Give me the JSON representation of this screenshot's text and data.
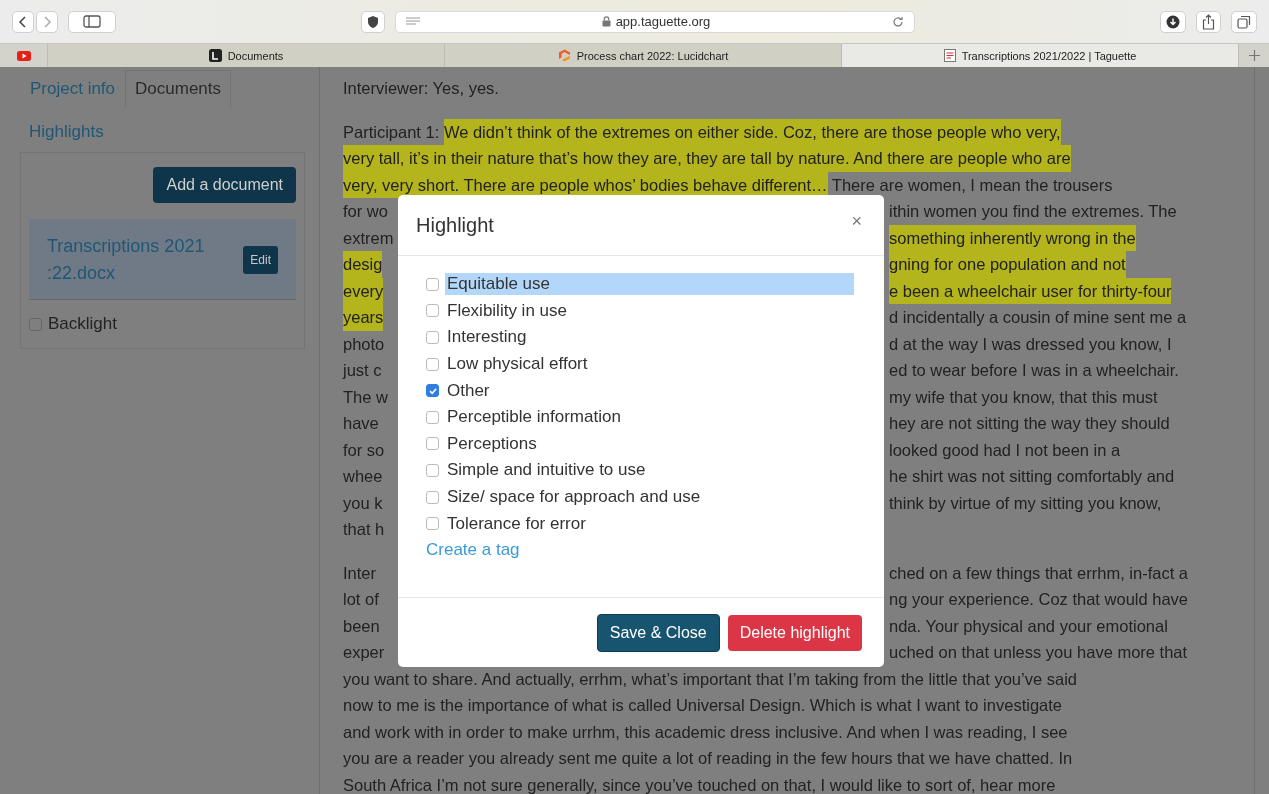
{
  "browser": {
    "address": "app.taguette.org",
    "tabs": [
      {
        "title": "Documents",
        "selected": false
      },
      {
        "title": "Process chart 2022: Lucidchart",
        "selected": false
      },
      {
        "title": "Transcriptions 2021/2022 | Taguette",
        "selected": true
      }
    ]
  },
  "sidebar": {
    "tabs": [
      {
        "label": "Project info",
        "selected": false
      },
      {
        "label": "Documents",
        "selected": true
      }
    ],
    "highlights_link": "Highlights",
    "add_button": "Add a document",
    "document": {
      "name_lines": [
        "Transcriptions 2021",
        ":22.docx"
      ],
      "edit": "Edit"
    },
    "filters": [
      {
        "label": "Backlight",
        "checked": false
      }
    ]
  },
  "document": {
    "paragraphs": [
      {
        "lines": [
          {
            "kind": "full",
            "segments": [
              {
                "text": "Interviewer: Yes, yes.",
                "highlighted": false
              }
            ]
          }
        ]
      },
      {
        "lines": [
          {
            "kind": "full",
            "segments": [
              {
                "text": "Participant 1: ",
                "highlighted": false
              },
              {
                "text": "We didn’t think of the extremes on either side. Coz, there are those people who very,",
                "highlighted": true
              }
            ]
          },
          {
            "kind": "full",
            "segments": [
              {
                "text": "very tall, it’s in their nature that’s how they are, they are tall by nature. And there are people who are",
                "highlighted": true
              }
            ]
          },
          {
            "kind": "full",
            "segments": [
              {
                "text": "very, very short. There are people whos’ bodies behave different…",
                "highlighted": true
              },
              {
                "text": " There are women, I mean the trousers",
                "highlighted": false
              }
            ]
          },
          {
            "kind": "split",
            "left": [
              {
                "text": "for wo",
                "highlighted": false
              }
            ],
            "right": [
              {
                "text": "ithin women you find the extremes. The",
                "highlighted": false
              }
            ]
          },
          {
            "kind": "split",
            "left": [
              {
                "text": "extrem",
                "highlighted": false
              }
            ],
            "right": [
              {
                "text": "something inherently wrong in the",
                "highlighted": true
              }
            ]
          },
          {
            "kind": "split",
            "left": [
              {
                "text": "desig",
                "highlighted": true
              }
            ],
            "right": [
              {
                "text": "gning for one population and not",
                "highlighted": true
              }
            ]
          },
          {
            "kind": "split",
            "left": [
              {
                "text": "every",
                "highlighted": true
              }
            ],
            "right": [
              {
                "text": "e been a wheelchair user for thirty-four",
                "highlighted": true
              }
            ]
          },
          {
            "kind": "split",
            "left": [
              {
                "text": "years",
                "highlighted": true
              }
            ],
            "right": [
              {
                "text": "d incidentally a cousin of mine sent me a",
                "highlighted": false
              }
            ]
          },
          {
            "kind": "split",
            "left": [
              {
                "text": "photo",
                "highlighted": false
              }
            ],
            "right": [
              {
                "text": "d at the way I was dressed you know, I",
                "highlighted": false
              }
            ]
          },
          {
            "kind": "split",
            "left": [
              {
                "text": "just c",
                "highlighted": false
              }
            ],
            "right": [
              {
                "text": "ed to wear before I was in a wheelchair.",
                "highlighted": false
              }
            ]
          },
          {
            "kind": "split",
            "left": [
              {
                "text": "The w",
                "highlighted": false
              }
            ],
            "right": [
              {
                "text": "my wife that you know, that this must",
                "highlighted": false
              }
            ]
          },
          {
            "kind": "split",
            "left": [
              {
                "text": "have",
                "highlighted": false
              }
            ],
            "right": [
              {
                "text": "hey are not sitting the way they should",
                "highlighted": false
              }
            ]
          },
          {
            "kind": "split",
            "left": [
              {
                "text": "for so",
                "highlighted": false
              }
            ],
            "right": [
              {
                "text": "looked good had I not been in a",
                "highlighted": false
              }
            ]
          },
          {
            "kind": "split",
            "left": [
              {
                "text": "whee",
                "highlighted": false
              }
            ],
            "right": [
              {
                "text": "he shirt was not sitting comfortably and",
                "highlighted": false
              }
            ]
          },
          {
            "kind": "split",
            "left": [
              {
                "text": "you k",
                "highlighted": false
              }
            ],
            "right": [
              {
                "text": "think by virtue of my sitting you know,",
                "highlighted": false
              }
            ]
          },
          {
            "kind": "split",
            "left": [
              {
                "text": "that h",
                "highlighted": false
              }
            ]
          }
        ]
      },
      {
        "lines": [
          {
            "kind": "split",
            "left": [
              {
                "text": "Inter",
                "highlighted": false
              }
            ],
            "right": [
              {
                "text": "ched on a few things that errhm, in-fact a",
                "highlighted": false
              }
            ]
          },
          {
            "kind": "split",
            "left": [
              {
                "text": "lot of",
                "highlighted": false
              }
            ],
            "right": [
              {
                "text": "ng your experience. Coz that would have",
                "highlighted": false
              }
            ]
          },
          {
            "kind": "split",
            "left": [
              {
                "text": "been",
                "highlighted": false
              }
            ],
            "right": [
              {
                "text": "nda. Your physical and your emotional",
                "highlighted": false
              }
            ]
          },
          {
            "kind": "split",
            "left": [
              {
                "text": "exper",
                "highlighted": false
              }
            ],
            "right": [
              {
                "text": "uched on that unless you have more that",
                "highlighted": false
              }
            ]
          },
          {
            "kind": "full",
            "segments": [
              {
                "text": "you want to share. And actually, errhm, what’s important that I’m taking from the little that you’ve said",
                "highlighted": false
              }
            ]
          },
          {
            "kind": "full",
            "segments": [
              {
                "text": "now to me is the importance of what is called Universal Design. Which is what I want to investigate",
                "highlighted": false
              }
            ]
          },
          {
            "kind": "full",
            "segments": [
              {
                "text": "and work with in order to make urrhm, this academic dress inclusive. And when I was reading, I see",
                "highlighted": false
              }
            ]
          },
          {
            "kind": "full",
            "segments": [
              {
                "text": "you are a reader you already sent me quite a lot of reading in the few hours that we have chatted. In",
                "highlighted": false
              }
            ]
          },
          {
            "kind": "full",
            "segments": [
              {
                "text": "South Africa I’m not sure generally, since you’ve touched on that, I would like to sort of, hear more",
                "highlighted": false
              }
            ]
          }
        ]
      }
    ]
  },
  "modal": {
    "title": "Highlight",
    "close": "×",
    "tags": [
      {
        "label": "Equitable use",
        "checked": false,
        "text_selected": true
      },
      {
        "label": "Flexibility in use",
        "checked": false,
        "text_selected": false
      },
      {
        "label": "Interesting",
        "checked": false,
        "text_selected": false
      },
      {
        "label": "Low physical effort",
        "checked": false,
        "text_selected": false
      },
      {
        "label": "Other",
        "checked": true,
        "text_selected": false
      },
      {
        "label": "Perceptible information",
        "checked": false,
        "text_selected": false
      },
      {
        "label": "Perceptions",
        "checked": false,
        "text_selected": false
      },
      {
        "label": "Simple and intuitive to use",
        "checked": false,
        "text_selected": false
      },
      {
        "label": "Size/ space for approach and use",
        "checked": false,
        "text_selected": false
      },
      {
        "label": "Tolerance for error",
        "checked": false,
        "text_selected": false
      }
    ],
    "create_link": "Create a tag",
    "buttons": [
      {
        "label": "Save & Close",
        "kind": "primary"
      },
      {
        "label": "Delete highlight",
        "kind": "danger"
      }
    ]
  }
}
